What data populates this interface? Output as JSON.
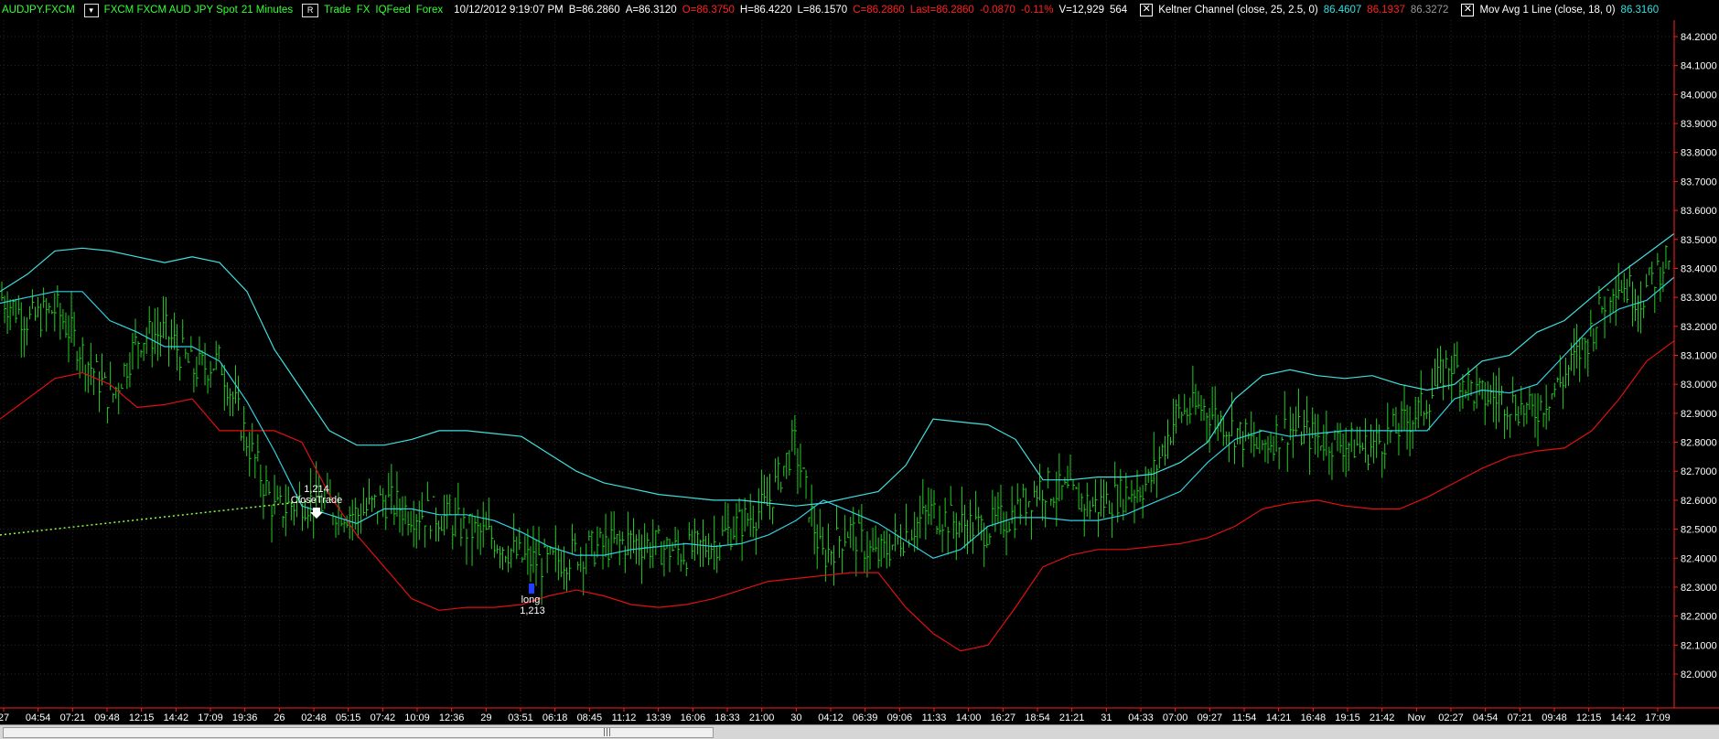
{
  "header": {
    "symbol": "AUDJPY.FXCM",
    "menu_icon": "dropdown-icon",
    "description": "FXCM FXCM AUD JPY Spot",
    "interval": "21 Minutes",
    "r_button": "R",
    "mode": "Trade",
    "exchange": "FX",
    "feed": "IQFeed",
    "asset": "Forex",
    "datetime": "10/12/2012  9:19:07 PM",
    "bid": "B=86.2860",
    "ask": "A=86.3120",
    "open": "O=86.3750",
    "high": "H=86.4220",
    "low": "L=86.1570",
    "close": "C=86.2860",
    "last": "Last=86.2860",
    "change": "-0.0870",
    "change_pct": "-0.11%",
    "volume": "V=12,929",
    "ticks": "564",
    "keltner_label": "Keltner Channel  (close,  25,  2.5,  0)",
    "keltner_upper": "86.4607",
    "keltner_lower": "86.1937",
    "keltner_mid": "86.3272",
    "mavg_label": "Mov Avg 1 Line  (close,  18,  0)",
    "mavg_value": "86.3160"
  },
  "colors": {
    "green": "#33ff33",
    "red": "#ff2020",
    "cyan": "#33e0e0",
    "gray": "#999999",
    "bars": "#22cc22",
    "keltner_upper_band": "#40e0e0",
    "keltner_lower_band": "#e01010",
    "moving_average": "#30d0e0"
  },
  "price_axis": {
    "labels": [
      "84.2000",
      "84.1000",
      "84.0000",
      "83.9000",
      "83.8000",
      "83.7000",
      "83.6000",
      "83.5000",
      "83.4000",
      "83.3000",
      "83.2000",
      "83.1000",
      "83.0000",
      "82.9000",
      "82.8000",
      "82.7000",
      "82.6000",
      "82.5000",
      "82.4000",
      "82.3000",
      "82.2000",
      "82.1000",
      "82.0000"
    ]
  },
  "time_axis": {
    "labels": [
      "27",
      "04:54",
      "07:21",
      "09:48",
      "12:15",
      "14:42",
      "17:09",
      "19:36",
      "26",
      "02:48",
      "05:15",
      "07:42",
      "10:09",
      "12:36",
      "29",
      "03:51",
      "06:18",
      "08:45",
      "11:12",
      "13:39",
      "16:06",
      "18:33",
      "21:00",
      "30",
      "04:12",
      "06:39",
      "09:06",
      "11:33",
      "14:00",
      "16:27",
      "18:54",
      "21:21",
      "31",
      "04:33",
      "07:00",
      "09:27",
      "11:54",
      "14:21",
      "16:48",
      "19:15",
      "21:42",
      "Nov",
      "02:27",
      "04:54",
      "07:21",
      "09:48",
      "12:15",
      "14:42",
      "17:09"
    ]
  },
  "trades": [
    {
      "label": "CloseTrade",
      "qty": "1,214",
      "marker": "down-arrow-icon"
    },
    {
      "label": "long",
      "qty": "1,213",
      "marker": "long-entry-icon"
    }
  ],
  "chart_data": {
    "type": "ohlc",
    "ylim": [
      81.95,
      84.3
    ],
    "keltner_upper": [
      83.32,
      83.38,
      83.46,
      83.47,
      83.46,
      83.44,
      83.42,
      83.44,
      83.42,
      83.32,
      83.12,
      82.98,
      82.84,
      82.79,
      82.79,
      82.81,
      82.84,
      82.84,
      82.83,
      82.82,
      82.76,
      82.7,
      82.66,
      82.64,
      82.62,
      82.61,
      82.6,
      82.6,
      82.59,
      82.58,
      82.59,
      82.61,
      82.63,
      82.72,
      82.88,
      82.87,
      82.86,
      82.81,
      82.67,
      82.67,
      82.68,
      82.68,
      82.69,
      82.73,
      82.8,
      82.95,
      83.03,
      83.05,
      83.03,
      83.02,
      83.03,
      83.0,
      82.98,
      83.0,
      83.08,
      83.1,
      83.18,
      83.22,
      83.3,
      83.38,
      83.45,
      83.52
    ],
    "keltner_lower": [
      82.88,
      82.95,
      83.02,
      83.04,
      83.0,
      82.92,
      82.93,
      82.95,
      82.84,
      82.84,
      82.84,
      82.8,
      82.62,
      82.48,
      82.37,
      82.26,
      82.22,
      82.23,
      82.23,
      82.24,
      82.27,
      82.29,
      82.27,
      82.24,
      82.23,
      82.24,
      82.26,
      82.29,
      82.32,
      82.33,
      82.34,
      82.35,
      82.35,
      82.23,
      82.14,
      82.08,
      82.1,
      82.23,
      82.37,
      82.41,
      82.43,
      82.43,
      82.44,
      82.45,
      82.47,
      82.51,
      82.57,
      82.59,
      82.6,
      82.58,
      82.57,
      82.57,
      82.61,
      82.66,
      82.71,
      82.75,
      82.77,
      82.78,
      82.84,
      82.95,
      83.08,
      83.15
    ],
    "moving_average": [
      83.28,
      83.3,
      83.32,
      83.32,
      83.22,
      83.18,
      83.13,
      83.13,
      83.08,
      82.94,
      82.77,
      82.58,
      82.55,
      82.52,
      82.57,
      82.57,
      82.55,
      82.55,
      82.53,
      82.49,
      82.44,
      82.41,
      82.41,
      82.43,
      82.44,
      82.45,
      82.44,
      82.45,
      82.48,
      82.53,
      82.6,
      82.56,
      82.52,
      82.46,
      82.4,
      82.43,
      82.51,
      82.54,
      82.54,
      82.53,
      82.53,
      82.55,
      82.59,
      82.63,
      82.73,
      82.81,
      82.84,
      82.82,
      82.83,
      82.84,
      82.84,
      82.84,
      82.84,
      82.95,
      82.98,
      82.97,
      83.0,
      83.1,
      83.2,
      83.26,
      83.29,
      83.37
    ],
    "close_series": [
      83.3,
      83.22,
      83.26,
      83.1,
      82.95,
      83.16,
      83.18,
      83.05,
      83.08,
      82.8,
      82.56,
      82.6,
      82.58,
      82.55,
      82.6,
      82.56,
      82.55,
      82.5,
      82.47,
      82.4,
      82.38,
      82.42,
      82.44,
      82.46,
      82.44,
      82.42,
      82.45,
      82.52,
      82.58,
      82.8,
      82.4,
      82.5,
      82.4,
      82.48,
      82.56,
      82.52,
      82.5,
      82.55,
      82.65,
      82.62,
      82.58,
      82.62,
      82.66,
      82.9,
      82.92,
      82.85,
      82.78,
      82.85,
      82.82,
      82.8,
      82.78,
      82.84,
      82.92,
      83.08,
      82.96,
      82.95,
      82.9,
      83.0,
      83.15,
      83.36,
      83.3,
      83.45
    ]
  }
}
